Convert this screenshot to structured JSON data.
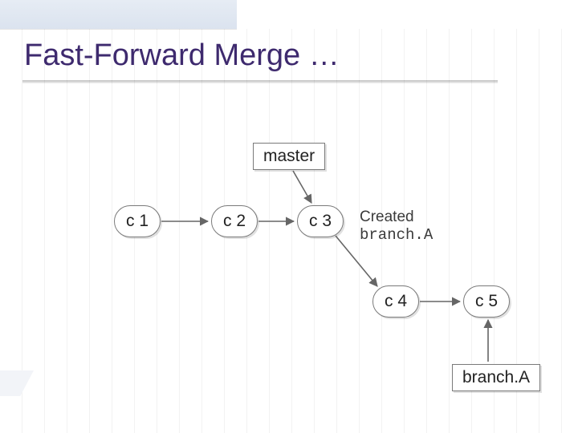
{
  "title": "Fast-Forward Merge …",
  "labels": {
    "master": "master",
    "branchA": "branch.A"
  },
  "commits": {
    "c1": "c 1",
    "c2": "c 2",
    "c3": "c 3",
    "c4": "c 4",
    "c5": "c 5"
  },
  "annot": {
    "created": "Created",
    "branchA_mono": "branch.A"
  },
  "chart_data": {
    "type": "diagram",
    "title": "Fast-Forward Merge …",
    "nodes": [
      {
        "id": "master",
        "kind": "branch-label",
        "label": "master"
      },
      {
        "id": "c1",
        "kind": "commit",
        "label": "c1"
      },
      {
        "id": "c2",
        "kind": "commit",
        "label": "c2"
      },
      {
        "id": "c3",
        "kind": "commit",
        "label": "c3"
      },
      {
        "id": "c4",
        "kind": "commit",
        "label": "c4"
      },
      {
        "id": "c5",
        "kind": "commit",
        "label": "c5"
      },
      {
        "id": "branchA",
        "kind": "branch-label",
        "label": "branch.A"
      },
      {
        "id": "annot-created",
        "kind": "annotation",
        "label": "Created branch.A"
      }
    ],
    "edges": [
      {
        "from": "master",
        "to": "c3",
        "kind": "points-to"
      },
      {
        "from": "c1",
        "to": "c2",
        "kind": "commit-order"
      },
      {
        "from": "c2",
        "to": "c3",
        "kind": "commit-order"
      },
      {
        "from": "c3",
        "to": "c4",
        "kind": "commit-order"
      },
      {
        "from": "c4",
        "to": "c5",
        "kind": "commit-order"
      },
      {
        "from": "branchA",
        "to": "c5",
        "kind": "points-to"
      }
    ]
  }
}
